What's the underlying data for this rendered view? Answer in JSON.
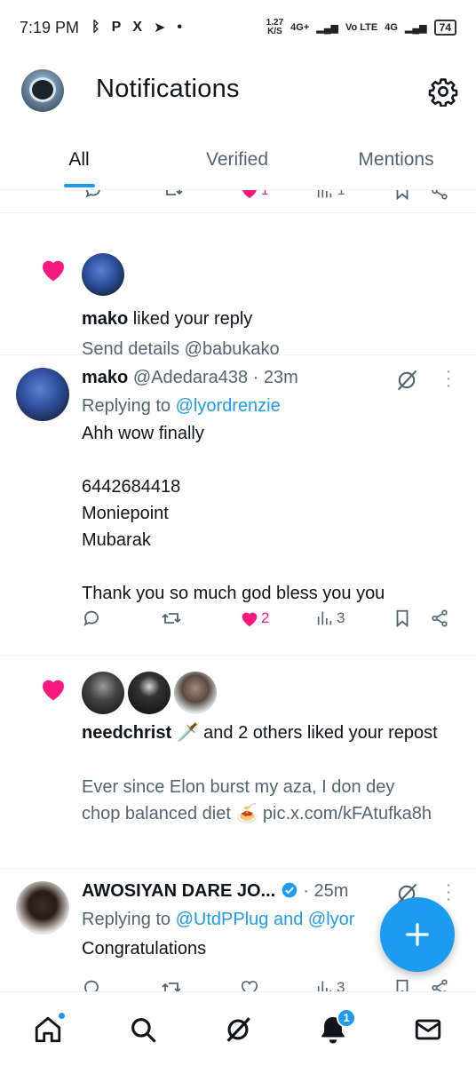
{
  "status_bar": {
    "time": "7:19 PM",
    "app_icons": [
      "ᛒ",
      "P",
      "X",
      "➤",
      "•"
    ],
    "speed_value": "1.27",
    "speed_unit": "K/S",
    "net1": "4G+",
    "net_volte": "Vo LTE",
    "net2": "4G",
    "battery": "74"
  },
  "header": {
    "title": "Notifications",
    "settings_icon": "gear-icon"
  },
  "tabs": [
    {
      "label": "All",
      "active": true
    },
    {
      "label": "Verified",
      "active": false
    },
    {
      "label": "Mentions",
      "active": false
    }
  ],
  "partial_actions": {
    "likes": "1",
    "views": "1"
  },
  "like_notification_1": {
    "user": "mako",
    "action": " liked your reply",
    "snippet": "Send details @babukako"
  },
  "reply_1": {
    "name": "mako",
    "handle": "@Adedara438",
    "time": "· 23m",
    "replying_prefix": "Replying to ",
    "replying_to": "@lyordrenzie",
    "lines": [
      "Ahh wow finally",
      "",
      "6442684418",
      "Moniepoint",
      "Mubarak",
      "",
      "Thank you so much god bless you you"
    ],
    "likes": "2",
    "views": "3"
  },
  "like_notification_2": {
    "user": "needchrist",
    "emoji": "🗡️",
    "action": " and 2 others liked your repost",
    "snippet": "Ever since Elon burst my aza, I don dey chop balanced diet 🍝 pic.x.com/kFAtufka8h"
  },
  "reply_2": {
    "name": "AWOSIYAN DARE JO...",
    "time": "· 25m",
    "replying_prefix": "Replying to ",
    "replying_to": "@UtdPPlug and @lyor",
    "text": "Congratulations",
    "views": "3"
  },
  "bottom_nav": {
    "items": [
      "home-icon",
      "search-icon",
      "grok-icon",
      "notifications-bell-icon",
      "messages-icon"
    ],
    "notification_count": "1"
  },
  "colors": {
    "accent": "#1d9bf0",
    "like": "#f91880",
    "text": "#0f1419",
    "muted": "#536471"
  }
}
